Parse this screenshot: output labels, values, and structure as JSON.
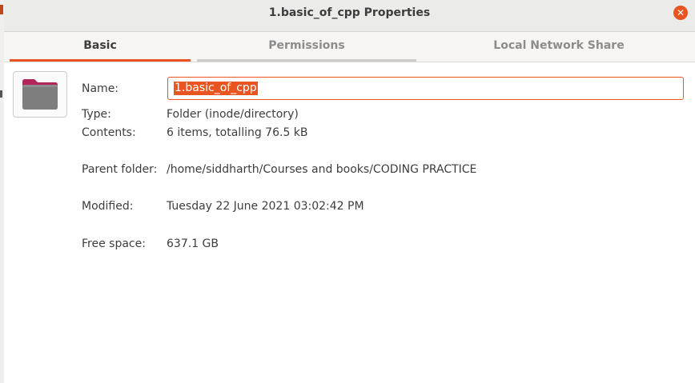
{
  "window": {
    "title": "1.basic_of_cpp Properties"
  },
  "tabs": [
    {
      "label": "Basic",
      "active": true
    },
    {
      "label": "Permissions",
      "active": false
    },
    {
      "label": "Local Network Share",
      "active": false
    }
  ],
  "icons": {
    "close": "close-icon",
    "folder": "folder-icon"
  },
  "colors": {
    "accent": "#e95420"
  },
  "basic": {
    "name_label": "Name:",
    "name_value": "1.basic_of_cpp",
    "type_label": "Type:",
    "type_value": "Folder (inode/directory)",
    "contents_label": "Contents:",
    "contents_value": "6 items, totalling 76.5 kB",
    "parent_label": "Parent folder:",
    "parent_value": "/home/siddharth/Courses and books/CODING PRACTICE",
    "modified_label": "Modified:",
    "modified_value": "Tuesday 22 June 2021 03:02:42 PM",
    "free_label": "Free space:",
    "free_value": "637.1 GB"
  }
}
